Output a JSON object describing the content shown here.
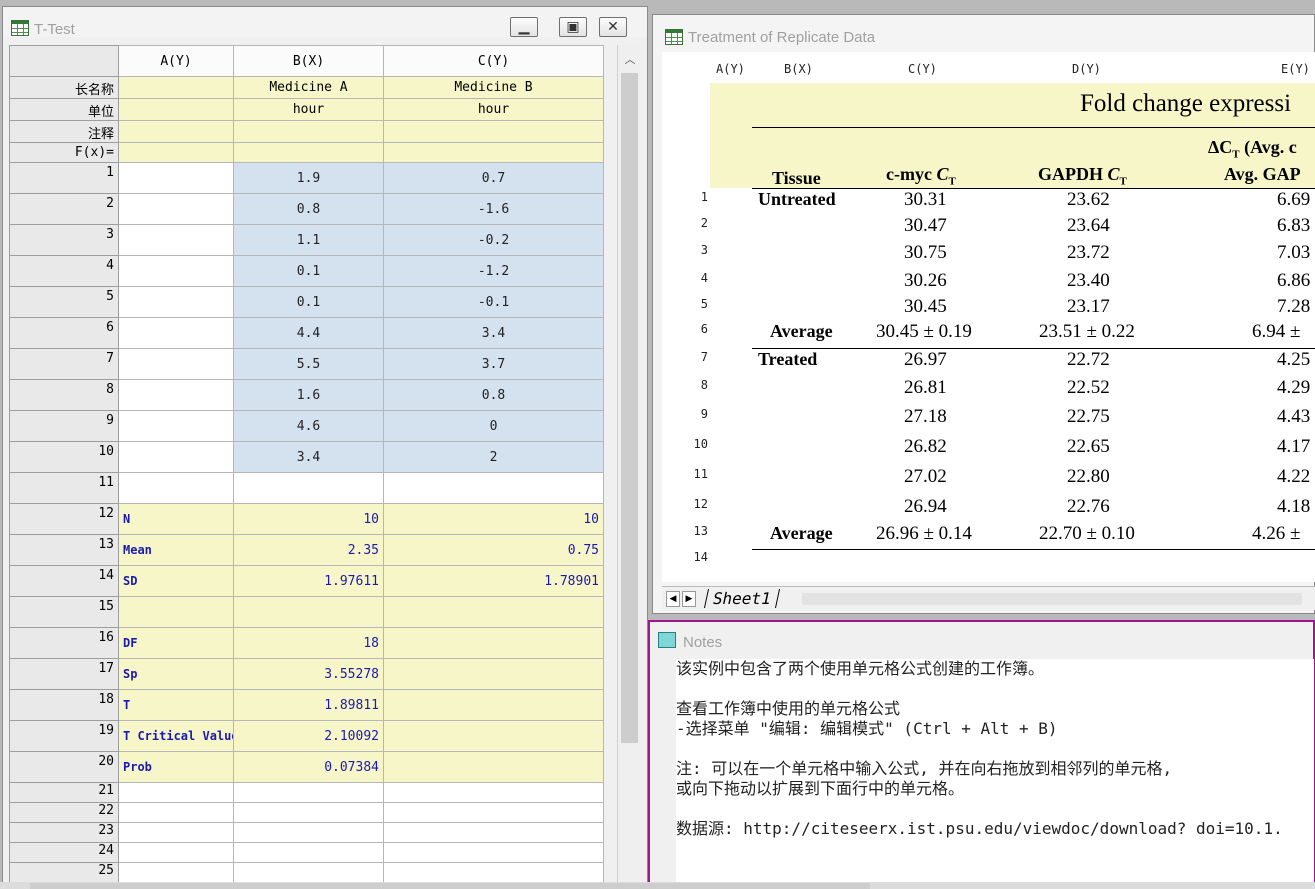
{
  "ttest": {
    "title": "T-Test",
    "columns": [
      "A(Y)",
      "B(X)",
      "C(Y)"
    ],
    "meta_labels": [
      "长名称",
      "单位",
      "注释",
      "F(x)="
    ],
    "long_names": [
      "",
      "Medicine A",
      "Medicine B"
    ],
    "units": [
      "",
      "hour",
      "hour"
    ],
    "data_rows": [
      {
        "n": "1",
        "b": "1.9",
        "c": "0.7"
      },
      {
        "n": "2",
        "b": "0.8",
        "c": "-1.6"
      },
      {
        "n": "3",
        "b": "1.1",
        "c": "-0.2"
      },
      {
        "n": "4",
        "b": "0.1",
        "c": "-1.2"
      },
      {
        "n": "5",
        "b": "0.1",
        "c": "-0.1"
      },
      {
        "n": "6",
        "b": "4.4",
        "c": "3.4"
      },
      {
        "n": "7",
        "b": "5.5",
        "c": "3.7"
      },
      {
        "n": "8",
        "b": "1.6",
        "c": "0.8"
      },
      {
        "n": "9",
        "b": "4.6",
        "c": "0"
      },
      {
        "n": "10",
        "b": "3.4",
        "c": "2"
      }
    ],
    "stat_rows": [
      {
        "n": "12",
        "label": "N",
        "b": "10",
        "c": "10"
      },
      {
        "n": "13",
        "label": "Mean",
        "b": "2.35",
        "c": "0.75"
      },
      {
        "n": "14",
        "label": "SD",
        "b": "1.97611",
        "c": "1.78901"
      },
      {
        "n": "15",
        "label": "",
        "b": "",
        "c": ""
      },
      {
        "n": "16",
        "label": "DF",
        "b": "18",
        "c": ""
      },
      {
        "n": "17",
        "label": "Sp",
        "b": "3.55278",
        "c": ""
      },
      {
        "n": "18",
        "label": "T",
        "b": "1.89811",
        "c": ""
      },
      {
        "n": "19",
        "label": "T Critical Value",
        "b": "2.10092",
        "c": ""
      },
      {
        "n": "20",
        "label": "Prob",
        "b": "0.07384",
        "c": ""
      }
    ],
    "empty_rows": [
      "21",
      "22",
      "23",
      "24",
      "25"
    ]
  },
  "replicate": {
    "title": "Treatment of Replicate Data",
    "columns": [
      "A(Y)",
      "B(X)",
      "C(Y)",
      "D(Y)",
      "E(Y)"
    ],
    "heading": "Fold change expressi",
    "header_top": "ΔC",
    "header_top_sub": "T",
    "header_top_rest": " (Avg. c",
    "hdr_tissue": "Tissue",
    "hdr_cmyc": "c-myc",
    "hdr_gapdh": "GAPDH",
    "hdr_ct": "C",
    "hdr_ct_sub": "T",
    "hdr_e": "Avg. GAP",
    "row_numbers": [
      "1",
      "2",
      "3",
      "4",
      "5",
      "6",
      "7",
      "8",
      "9",
      "10",
      "11",
      "12",
      "13",
      "14"
    ],
    "rows": [
      {
        "tissue": "Untreated",
        "c": "30.31",
        "d": "23.62",
        "e": "6.69"
      },
      {
        "tissue": "",
        "c": "30.47",
        "d": "23.64",
        "e": "6.83"
      },
      {
        "tissue": "",
        "c": "30.75",
        "d": "23.72",
        "e": "7.03"
      },
      {
        "tissue": "",
        "c": "30.26",
        "d": "23.40",
        "e": "6.86"
      },
      {
        "tissue": "",
        "c": "30.45",
        "d": "23.17",
        "e": "7.28"
      },
      {
        "tissue": "Average",
        "c": "30.45 ± 0.19",
        "d": "23.51 ± 0.22",
        "e": "6.94 ±"
      },
      {
        "tissue": "Treated",
        "c": "26.97",
        "d": "22.72",
        "e": "4.25"
      },
      {
        "tissue": "",
        "c": "26.81",
        "d": "22.52",
        "e": "4.29"
      },
      {
        "tissue": "",
        "c": "27.18",
        "d": "22.75",
        "e": "4.43"
      },
      {
        "tissue": "",
        "c": "26.82",
        "d": "22.65",
        "e": "4.17"
      },
      {
        "tissue": "",
        "c": "27.02",
        "d": "22.80",
        "e": "4.22"
      },
      {
        "tissue": "",
        "c": "26.94",
        "d": "22.76",
        "e": "4.18"
      },
      {
        "tissue": "Average",
        "c": "26.96 ± 0.14",
        "d": "22.70 ± 0.10",
        "e": "4.26 ±"
      }
    ],
    "sheet_tab": "Sheet1"
  },
  "notes": {
    "title": "Notes",
    "lines": [
      "该实例中包含了两个使用单元格公式创建的工作簿。",
      "",
      "查看工作簿中使用的单元格公式",
      "-选择菜单 \"编辑: 编辑模式\" (Ctrl + Alt + B)",
      "",
      "注: 可以在一个单元格中输入公式, 并在向右拖放到相邻列的单元格,",
      "或向下拖动以扩展到下面行中的单元格。",
      "",
      "数据源: http://citeseerx.ist.psu.edu/viewdoc/download? doi=10.1."
    ]
  },
  "colors": {
    "label_row": "#f7f6c9",
    "data_cell": "#d4e1ef",
    "stat_text": "#1a1ab0",
    "notes_border": "#a0168f"
  }
}
